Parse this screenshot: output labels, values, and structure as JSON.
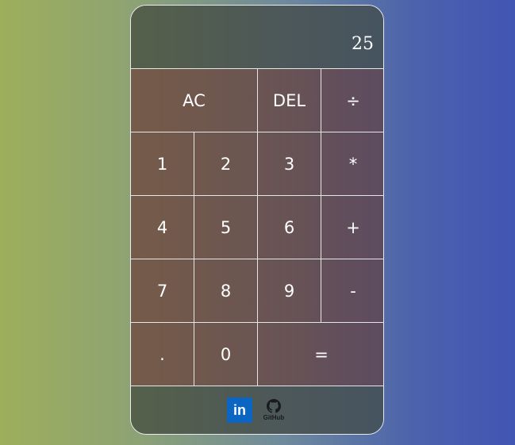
{
  "display": {
    "value": "25"
  },
  "keys": {
    "ac": "AC",
    "del": "DEL",
    "divide": "÷",
    "one": "1",
    "two": "2",
    "three": "3",
    "multiply": "*",
    "four": "4",
    "five": "5",
    "six": "6",
    "plus": "+",
    "seven": "7",
    "eight": "8",
    "nine": "9",
    "minus": "-",
    "dot": ".",
    "zero": "0",
    "equals": "="
  },
  "footer": {
    "linkedin_icon": "linkedin-icon",
    "linkedin_text": "in",
    "github_icon": "github-icon",
    "github_label": "GitHub"
  },
  "colors": {
    "linkedin": "#0a66c2",
    "grid_lines": "#e6e6e6",
    "text": "#ffffff"
  }
}
